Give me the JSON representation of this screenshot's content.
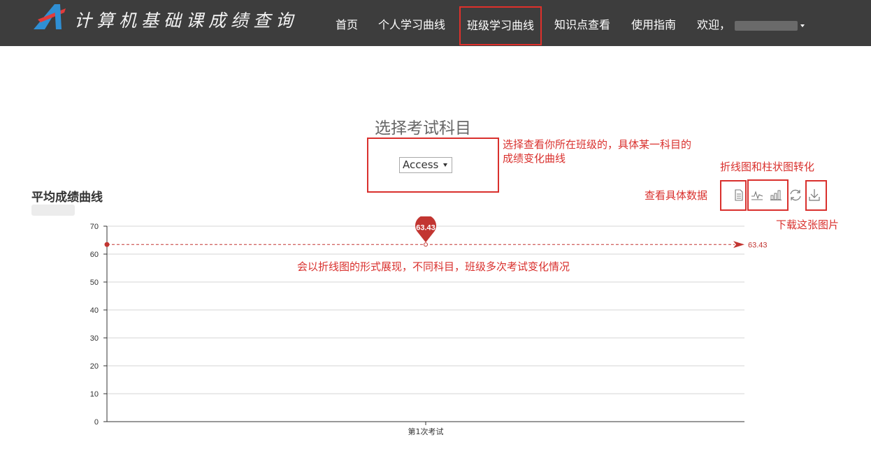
{
  "navbar": {
    "brand": "计算机基础课成绩查询",
    "items": [
      {
        "label": "首页"
      },
      {
        "label": "个人学习曲线"
      },
      {
        "label": "班级学习曲线"
      },
      {
        "label": "知识点查看"
      },
      {
        "label": "使用指南"
      }
    ],
    "welcome": "欢迎，",
    "active_item": "班级学习曲线"
  },
  "subject_select": {
    "title": "选择考试科目",
    "selected": "Access"
  },
  "annotations": {
    "select_note_line1": "选择查看你所在班级的，具体某一科目的",
    "select_note_line2": "成绩变化曲线",
    "switch_note": "折线图和柱状图转化",
    "view_data_note": "查看具体数据",
    "download_note": "下载这张图片",
    "chart_note": "会以折线图的形式展现，不同科目，班级多次考试变化情况"
  },
  "chart_section": {
    "title": "平均成绩曲线"
  },
  "toolbox": [
    {
      "icon": "data-view-icon"
    },
    {
      "icon": "line-chart-icon"
    },
    {
      "icon": "bar-chart-icon"
    },
    {
      "icon": "restore-icon"
    },
    {
      "icon": "download-icon"
    }
  ],
  "colors": {
    "navbar_bg": "#3d3d3d",
    "accent_red": "#c23531",
    "annotation_red": "#d9302d"
  },
  "chart_data": {
    "type": "line",
    "categories": [
      "第1次考试"
    ],
    "series": [
      {
        "values": [
          63.43
        ],
        "markPoint": "63.43",
        "markLine": "63.43"
      }
    ],
    "yticks": [
      0,
      10,
      20,
      30,
      40,
      50,
      60,
      70
    ],
    "ylim": [
      0,
      70
    ],
    "grid": true,
    "point_label": "63.43",
    "avg_line_label": "63.43"
  }
}
